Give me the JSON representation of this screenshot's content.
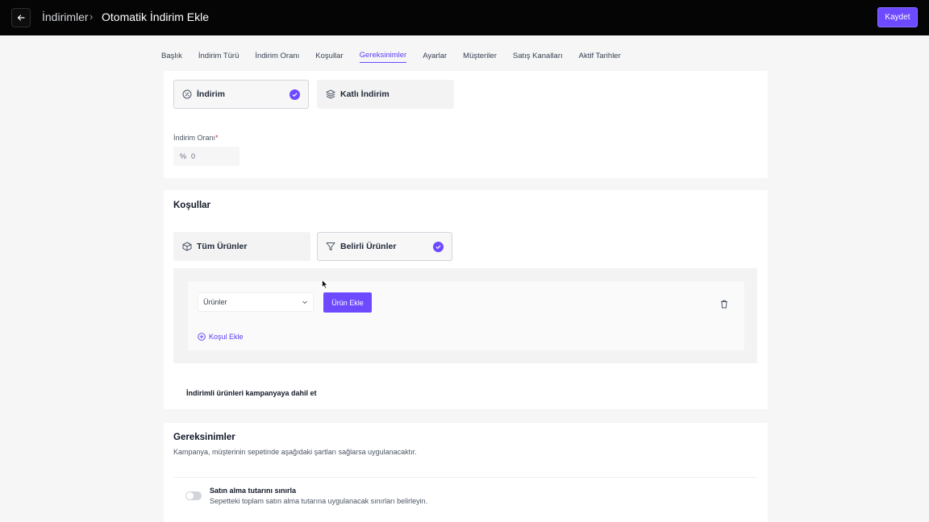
{
  "header": {
    "back_icon": "arrow-left-icon",
    "breadcrumb_root": "İndirimler",
    "breadcrumb_separator": "›",
    "breadcrumb_current": "Otomatik İndirim Ekle",
    "save_label": "Kaydet",
    "accent_color": "#6d4aff"
  },
  "tabs": [
    {
      "label": "Başlık",
      "active": false
    },
    {
      "label": "İndirim Türü",
      "active": false
    },
    {
      "label": "İndirim Oranı",
      "active": false
    },
    {
      "label": "Koşullar",
      "active": false
    },
    {
      "label": "Gereksinimler",
      "active": true
    },
    {
      "label": "Ayarlar",
      "active": false
    },
    {
      "label": "Müşteriler",
      "active": false
    },
    {
      "label": "Satış Kanalları",
      "active": false
    },
    {
      "label": "Aktif Tarihler",
      "active": false
    }
  ],
  "discount_type": {
    "options": [
      {
        "label": "İndirim",
        "icon": "percent-badge-icon",
        "selected": true
      },
      {
        "label": "Katlı İndirim",
        "icon": "layers-icon",
        "selected": false
      }
    ]
  },
  "discount_rate": {
    "label": "İndirim Oranı",
    "required_mark": "*",
    "prefix": "%",
    "value": "0"
  },
  "conditions": {
    "title": "Koşullar",
    "options": [
      {
        "label": "Tüm Ürünler",
        "icon": "box-icon",
        "selected": false
      },
      {
        "label": "Belirli Ürünler",
        "icon": "filter-icon",
        "selected": true
      }
    ],
    "select_value": "Ürünler",
    "add_product_label": "Ürün Ekle",
    "add_condition_label": "Koşul Ekle",
    "include_label": "İndirimli ürünleri kampanyaya dahil et"
  },
  "requirements": {
    "title": "Gereksinimler",
    "description": "Kampanya, müşterinin sepetinde aşağıdaki şartları sağlarsa uygulanacaktır.",
    "toggle_title": "Satın alma tutarını sınırla",
    "toggle_description": "Sepetteki toplam satın alma tutarına uygulanacak sınırları belirleyin.",
    "toggle_on": false
  }
}
